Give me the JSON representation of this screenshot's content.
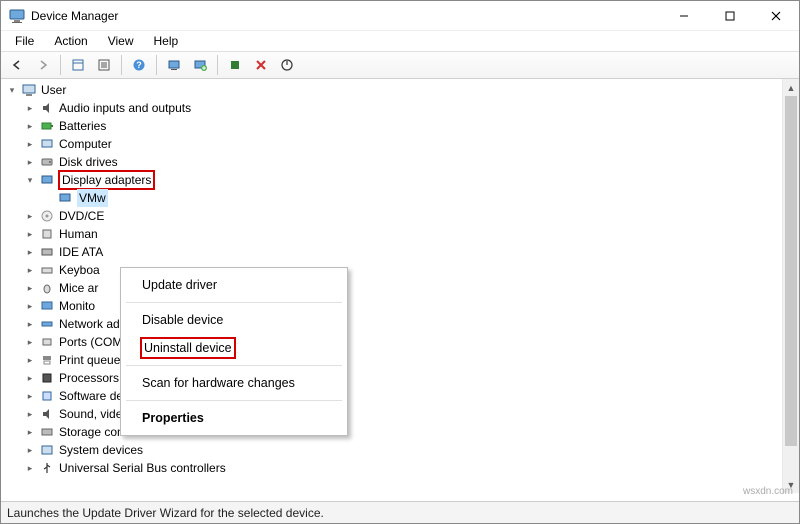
{
  "window": {
    "title": "Device Manager"
  },
  "menus": {
    "file": "File",
    "action": "Action",
    "view": "View",
    "help": "Help"
  },
  "tree": {
    "root": "User",
    "items": [
      "Audio inputs and outputs",
      "Batteries",
      "Computer",
      "Disk drives",
      "Display adapters",
      "VMw",
      "DVD/CE",
      "Human",
      "IDE ATA",
      "Keyboa",
      "Mice ar",
      "Monito",
      "Network adapters",
      "Ports (COM & LPT)",
      "Print queues",
      "Processors",
      "Software devices",
      "Sound, video and game controllers",
      "Storage controllers",
      "System devices",
      "Universal Serial Bus controllers"
    ]
  },
  "context_menu": {
    "update": "Update driver",
    "disable": "Disable device",
    "uninstall": "Uninstall device",
    "scan": "Scan for hardware changes",
    "properties": "Properties"
  },
  "status": "Launches the Update Driver Wizard for the selected device.",
  "watermark": "wsxdn.com"
}
